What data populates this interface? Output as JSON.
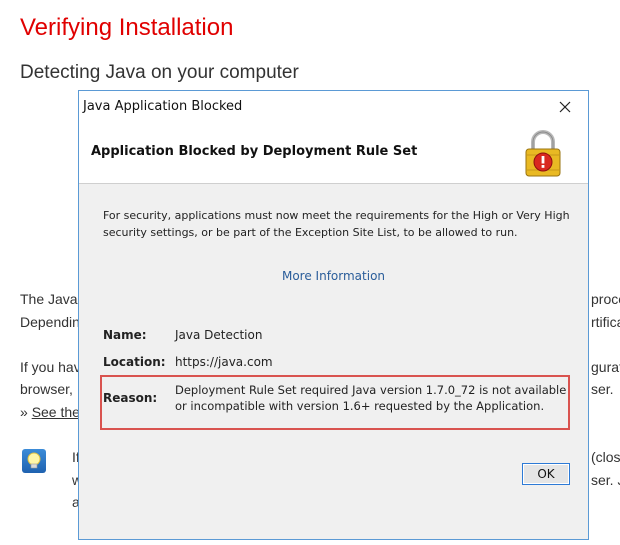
{
  "background": {
    "title": "Verifying Installation",
    "subtitle": "Detecting Java on your computer",
    "fragments": {
      "p1_line1_left": "The Java",
      "p1_line1_right": "proce",
      "p1_line2_left": "Dependin",
      "p1_line2_right": "rtifica",
      "p2_line1_left": "If you hav",
      "p2_line1_right": "gurat",
      "p2_line2_left": "browser,",
      "p2_line2_right": "ser.",
      "p2_line3_prefix": "» ",
      "p2_link": "See the",
      "tip_line1_left": "If",
      "tip_line1_right": "(clos",
      "tip_line2_left": "w",
      "tip_line2_right": "ser. J",
      "tip_line3_left": "a"
    }
  },
  "dialog": {
    "window_title": "Java Application Blocked",
    "heading": "Application Blocked by Deployment Rule Set",
    "message": "For security, applications must now meet the requirements for the High or Very High security settings, or be part of the Exception Site List, to be allowed to run.",
    "more_info": "More Information",
    "fields": {
      "name_label": "Name:",
      "name_value": "Java Detection",
      "location_label": "Location:",
      "location_value": "https://java.com",
      "reason_label": "Reason:",
      "reason_value": "Deployment Rule Set required Java version 1.7.0_72 is not available or incompatible with version 1.6+ requested by the Application."
    },
    "ok_label": "OK",
    "icons": {
      "close": "close-icon",
      "lock": "lock-warning-icon",
      "tip": "lightbulb-icon"
    },
    "colors": {
      "highlight_border": "#d9534f",
      "link": "#2a5d9a",
      "page_title": "#e00000",
      "window_border": "#5b9ad5"
    }
  }
}
